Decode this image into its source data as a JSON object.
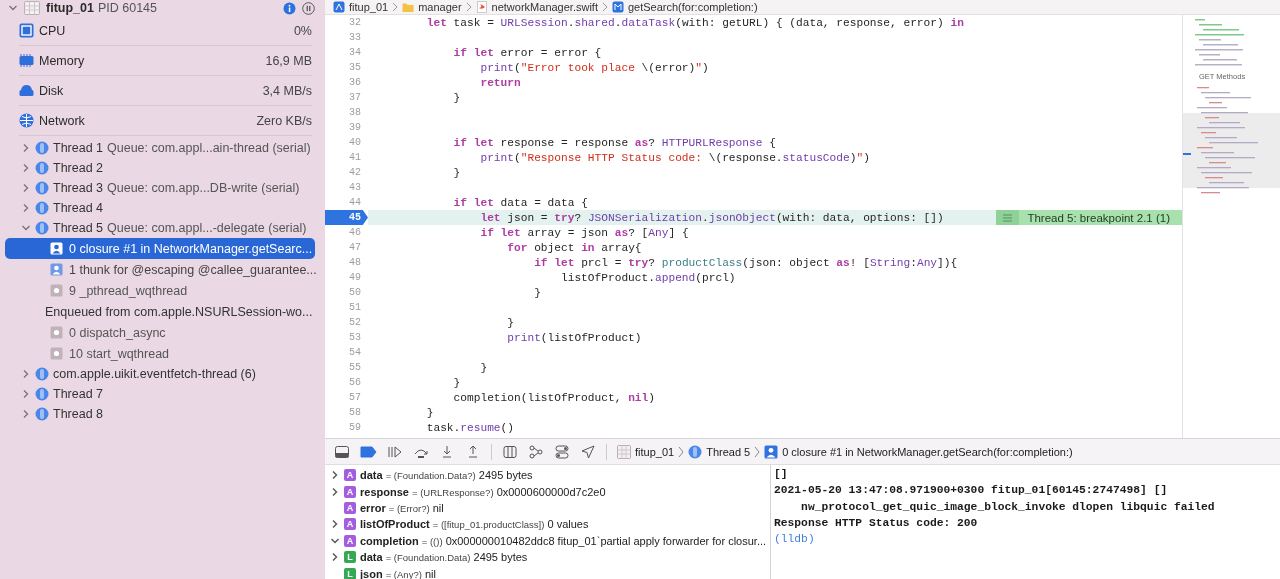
{
  "process": {
    "name": "fitup_01",
    "pid": "PID 60145",
    "expanded": true
  },
  "gauges": [
    {
      "kind": "cpu",
      "label": "CPU",
      "value": "0%"
    },
    {
      "kind": "memory",
      "label": "Memory",
      "value": "16,9 MB"
    },
    {
      "kind": "disk",
      "label": "Disk",
      "value": "3,4 MB/s"
    },
    {
      "kind": "network",
      "label": "Network",
      "value": "Zero KB/s"
    }
  ],
  "threads": [
    {
      "label": "Thread 1",
      "queue": "Queue: com.appl...ain-thread (serial)",
      "expanded": false
    },
    {
      "label": "Thread 2",
      "expanded": false
    },
    {
      "label": "Thread 3",
      "queue": "Queue: com.app...DB-write (serial)",
      "expanded": false
    },
    {
      "label": "Thread 4",
      "expanded": false
    },
    {
      "label": "Thread 5",
      "queue": "Queue: com.appl...-delegate (serial)",
      "expanded": true,
      "frames": [
        {
          "kind": "user",
          "text": "0 closure #1 in NetworkManager.getSearc...",
          "selected": true
        },
        {
          "kind": "user",
          "text": "1 thunk for @escaping @callee_guarantee...",
          "selected": false
        },
        {
          "kind": "system",
          "text": "9 _pthread_wqthread",
          "selected": false
        },
        {
          "kind": "enqueued",
          "text": "Enqueued from com.apple.NSURLSession-wo...",
          "selected": false
        },
        {
          "kind": "system",
          "text": "0 dispatch_async",
          "selected": false
        },
        {
          "kind": "system",
          "text": "10 start_wqthread",
          "selected": false
        }
      ]
    },
    {
      "label": "com.apple.uikit.eventfetch-thread (6)",
      "expanded": false
    },
    {
      "label": "Thread 7",
      "expanded": false
    },
    {
      "label": "Thread 8",
      "expanded": false
    }
  ],
  "editor": {
    "breadcrumb": [
      {
        "kind": "project",
        "text": "fitup_01"
      },
      {
        "kind": "folder",
        "text": "manager"
      },
      {
        "kind": "swift",
        "text": "networkManager.swift"
      },
      {
        "kind": "method",
        "text": "getSearch(for:completion:)"
      }
    ],
    "lines": [
      {
        "number": "32",
        "current": false,
        "breakpoint": false,
        "tokens": [
          {
            "kind": "keyword",
            "text": "        let"
          },
          {
            "kind": "plain",
            "text": " task = "
          },
          {
            "kind": "type",
            "text": "URLSession"
          },
          {
            "kind": "plain",
            "text": "."
          },
          {
            "kind": "type",
            "text": "shared"
          },
          {
            "kind": "plain",
            "text": "."
          },
          {
            "kind": "type",
            "text": "dataTask"
          },
          {
            "kind": "plain",
            "text": "(with: getURL) { (data, response, error) "
          },
          {
            "kind": "keyword",
            "text": "in"
          }
        ]
      },
      {
        "number": "33",
        "current": false,
        "breakpoint": false
      },
      {
        "number": "34",
        "current": false,
        "breakpoint": false,
        "tokens": [
          {
            "kind": "keyword",
            "text": "            if let"
          },
          {
            "kind": "plain",
            "text": " error = error {"
          }
        ]
      },
      {
        "number": "35",
        "current": false,
        "breakpoint": false,
        "tokens": [
          {
            "kind": "type",
            "text": "                print"
          },
          {
            "kind": "plain",
            "text": "("
          },
          {
            "kind": "string",
            "text": "\"Error took place "
          },
          {
            "kind": "plain",
            "text": "\\(error)"
          },
          {
            "kind": "string",
            "text": "\""
          },
          {
            "kind": "plain",
            "text": ")"
          }
        ]
      },
      {
        "number": "36",
        "current": false,
        "breakpoint": false,
        "tokens": [
          {
            "kind": "keyword",
            "text": "                return"
          }
        ]
      },
      {
        "number": "37",
        "current": false,
        "breakpoint": false,
        "tokens": [
          {
            "kind": "plain",
            "text": "            }"
          }
        ]
      },
      {
        "number": "38",
        "current": false,
        "breakpoint": false
      },
      {
        "number": "39",
        "current": false,
        "breakpoint": false
      },
      {
        "number": "40",
        "current": false,
        "breakpoint": false,
        "tokens": [
          {
            "kind": "keyword",
            "text": "            if let"
          },
          {
            "kind": "plain",
            "text": " response = response "
          },
          {
            "kind": "keyword",
            "text": "as"
          },
          {
            "kind": "plain",
            "text": "? "
          },
          {
            "kind": "type",
            "text": "HTTPURLResponse"
          },
          {
            "kind": "plain",
            "text": " {"
          }
        ]
      },
      {
        "number": "41",
        "current": false,
        "breakpoint": false,
        "tokens": [
          {
            "kind": "type",
            "text": "                print"
          },
          {
            "kind": "plain",
            "text": "("
          },
          {
            "kind": "string",
            "text": "\"Response HTTP Status code: "
          },
          {
            "kind": "plain",
            "text": "\\(response."
          },
          {
            "kind": "type",
            "text": "statusCode"
          },
          {
            "kind": "plain",
            "text": ")"
          },
          {
            "kind": "string",
            "text": "\""
          },
          {
            "kind": "plain",
            "text": ")"
          }
        ]
      },
      {
        "number": "42",
        "current": false,
        "breakpoint": false,
        "tokens": [
          {
            "kind": "plain",
            "text": "            }"
          }
        ]
      },
      {
        "number": "43",
        "current": false,
        "breakpoint": false
      },
      {
        "number": "44",
        "current": false,
        "breakpoint": false,
        "tokens": [
          {
            "kind": "keyword",
            "text": "            if let"
          },
          {
            "kind": "plain",
            "text": " data = data {"
          }
        ]
      },
      {
        "number": "45",
        "current": true,
        "breakpoint": true,
        "annotation": "Thread 5: breakpoint 2.1 (1)",
        "tokens": [
          {
            "kind": "keyword",
            "text": "                let"
          },
          {
            "kind": "plain",
            "text": " json = "
          },
          {
            "kind": "keyword",
            "text": "try"
          },
          {
            "kind": "plain",
            "text": "? "
          },
          {
            "kind": "type",
            "text": "JSONSerialization"
          },
          {
            "kind": "plain",
            "text": "."
          },
          {
            "kind": "type",
            "text": "jsonObject"
          },
          {
            "kind": "plain",
            "text": "(with: data, options: [])"
          }
        ]
      },
      {
        "number": "46",
        "current": false,
        "breakpoint": false,
        "tokens": [
          {
            "kind": "keyword",
            "text": "                if let"
          },
          {
            "kind": "plain",
            "text": " array = json "
          },
          {
            "kind": "keyword",
            "text": "as"
          },
          {
            "kind": "plain",
            "text": "? ["
          },
          {
            "kind": "type",
            "text": "Any"
          },
          {
            "kind": "plain",
            "text": "] {"
          }
        ]
      },
      {
        "number": "47",
        "current": false,
        "breakpoint": false,
        "tokens": [
          {
            "kind": "keyword",
            "text": "                    for"
          },
          {
            "kind": "plain",
            "text": " object "
          },
          {
            "kind": "keyword",
            "text": "in"
          },
          {
            "kind": "plain",
            "text": " array{"
          }
        ]
      },
      {
        "number": "48",
        "current": false,
        "breakpoint": false,
        "tokens": [
          {
            "kind": "keyword",
            "text": "                        if let"
          },
          {
            "kind": "plain",
            "text": " prcl = "
          },
          {
            "kind": "keyword",
            "text": "try"
          },
          {
            "kind": "plain",
            "text": "? "
          },
          {
            "kind": "project",
            "text": "productClass"
          },
          {
            "kind": "plain",
            "text": "(json: object "
          },
          {
            "kind": "keyword",
            "text": "as"
          },
          {
            "kind": "plain",
            "text": "! ["
          },
          {
            "kind": "type",
            "text": "String"
          },
          {
            "kind": "plain",
            "text": ":"
          },
          {
            "kind": "type",
            "text": "Any"
          },
          {
            "kind": "plain",
            "text": "]){"
          }
        ]
      },
      {
        "number": "49",
        "current": false,
        "breakpoint": false,
        "tokens": [
          {
            "kind": "plain",
            "text": "                            listOfProduct."
          },
          {
            "kind": "type",
            "text": "append"
          },
          {
            "kind": "plain",
            "text": "(prcl)"
          }
        ]
      },
      {
        "number": "50",
        "current": false,
        "breakpoint": false,
        "tokens": [
          {
            "kind": "plain",
            "text": "                        }"
          }
        ]
      },
      {
        "number": "51",
        "current": false,
        "breakpoint": false
      },
      {
        "number": "52",
        "current": false,
        "breakpoint": false,
        "tokens": [
          {
            "kind": "plain",
            "text": "                    }"
          }
        ]
      },
      {
        "number": "53",
        "current": false,
        "breakpoint": false,
        "tokens": [
          {
            "kind": "type",
            "text": "                    print"
          },
          {
            "kind": "plain",
            "text": "(listOfProduct)"
          }
        ]
      },
      {
        "number": "54",
        "current": false,
        "breakpoint": false
      },
      {
        "number": "55",
        "current": false,
        "breakpoint": false,
        "tokens": [
          {
            "kind": "plain",
            "text": "                }"
          }
        ]
      },
      {
        "number": "56",
        "current": false,
        "breakpoint": false,
        "tokens": [
          {
            "kind": "plain",
            "text": "            }"
          }
        ]
      },
      {
        "number": "57",
        "current": false,
        "breakpoint": false,
        "tokens": [
          {
            "kind": "plain",
            "text": "            completion(listOfProduct, "
          },
          {
            "kind": "keyword",
            "text": "nil"
          },
          {
            "kind": "plain",
            "text": ")"
          }
        ]
      },
      {
        "number": "58",
        "current": false,
        "breakpoint": false,
        "tokens": [
          {
            "kind": "plain",
            "text": "        }"
          }
        ]
      },
      {
        "number": "59",
        "current": false,
        "breakpoint": false,
        "tokens": [
          {
            "kind": "plain",
            "text": "        task."
          },
          {
            "kind": "type",
            "text": "resume"
          },
          {
            "kind": "plain",
            "text": "()"
          }
        ]
      }
    ],
    "minimap": {
      "heading": "GET Methods"
    }
  },
  "debug_bar": {
    "breakpoints_active": true,
    "path": [
      {
        "kind": "project",
        "text": "fitup_01"
      },
      {
        "kind": "thread",
        "text": "Thread 5"
      },
      {
        "kind": "frame",
        "text": "0 closure #1 in NetworkManager.getSearch(for:completion:)"
      }
    ]
  },
  "variables": [
    {
      "scope": "A",
      "name": "data",
      "type": "= (Foundation.Data?)",
      "value": "2495 bytes",
      "expanded": false
    },
    {
      "scope": "A",
      "name": "response",
      "type": "= (URLResponse?)",
      "value": "0x0000600000d7c2e0",
      "expanded": false
    },
    {
      "scope": "A",
      "name": "error",
      "type": "= (Error?)",
      "value": "nil"
    },
    {
      "scope": "A",
      "name": "listOfProduct",
      "type": "= ([fitup_01.productClass])",
      "value": "0 values",
      "expanded": false
    },
    {
      "scope": "A",
      "name": "completion",
      "type": "= (())",
      "value": "0x000000010482ddc8 fitup_01`partial apply forwarder for closur...",
      "expanded": true
    },
    {
      "scope": "L",
      "name": "data",
      "type": "= (Foundation.Data)",
      "value": "2495 bytes",
      "expanded": false
    },
    {
      "scope": "L",
      "name": "json",
      "type": "= (Any?)",
      "value": "nil"
    }
  ],
  "console": [
    {
      "kind": "output",
      "text": "[]"
    },
    {
      "kind": "output",
      "text": "2021-05-20 13:47:08.971900+0300 fitup_01[60145:2747498] []"
    },
    {
      "kind": "output",
      "text": "    nw_protocol_get_quic_image_block_invoke dlopen libquic failed"
    },
    {
      "kind": "output",
      "text": "Response HTTP Status code: 200"
    },
    {
      "kind": "prompt",
      "text": "(lldb)"
    }
  ]
}
